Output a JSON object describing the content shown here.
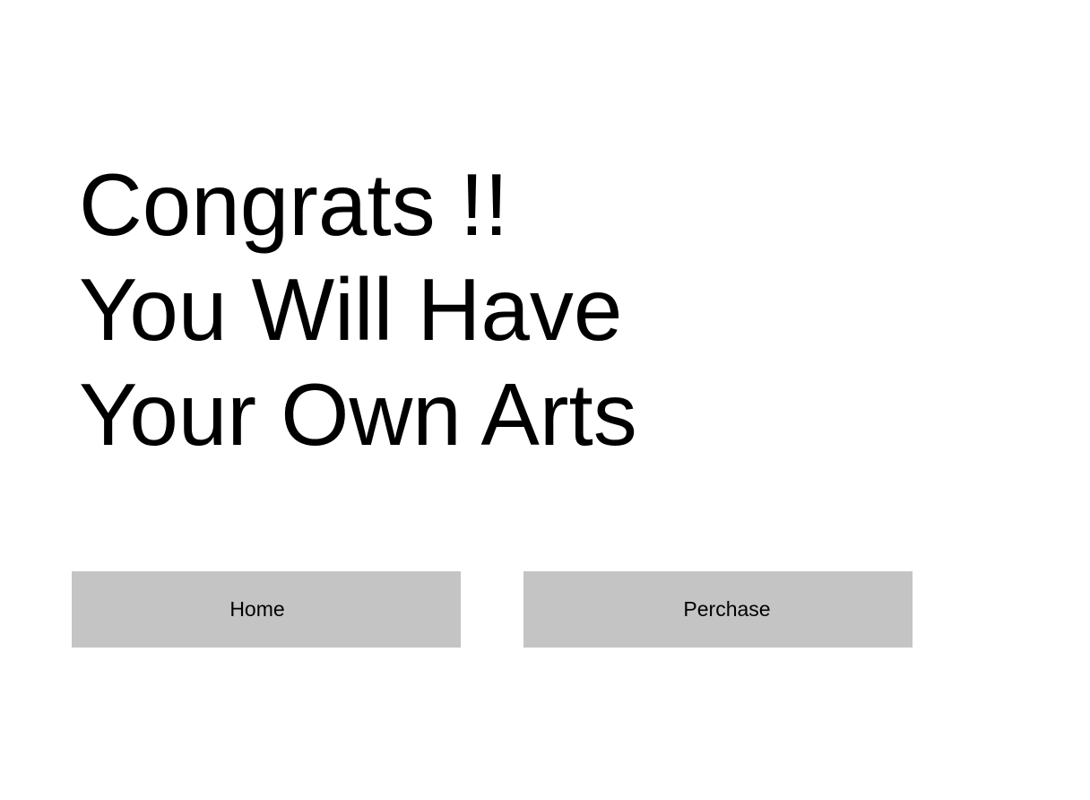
{
  "headline": {
    "lines": [
      "Congrats !!",
      "You Will Have",
      "Your Own Arts"
    ]
  },
  "buttons": {
    "home_label": "Home",
    "purchase_label": "Perchase"
  },
  "colors": {
    "background": "#ffffff",
    "text": "#000000",
    "button_background": "#c4c4c4"
  }
}
